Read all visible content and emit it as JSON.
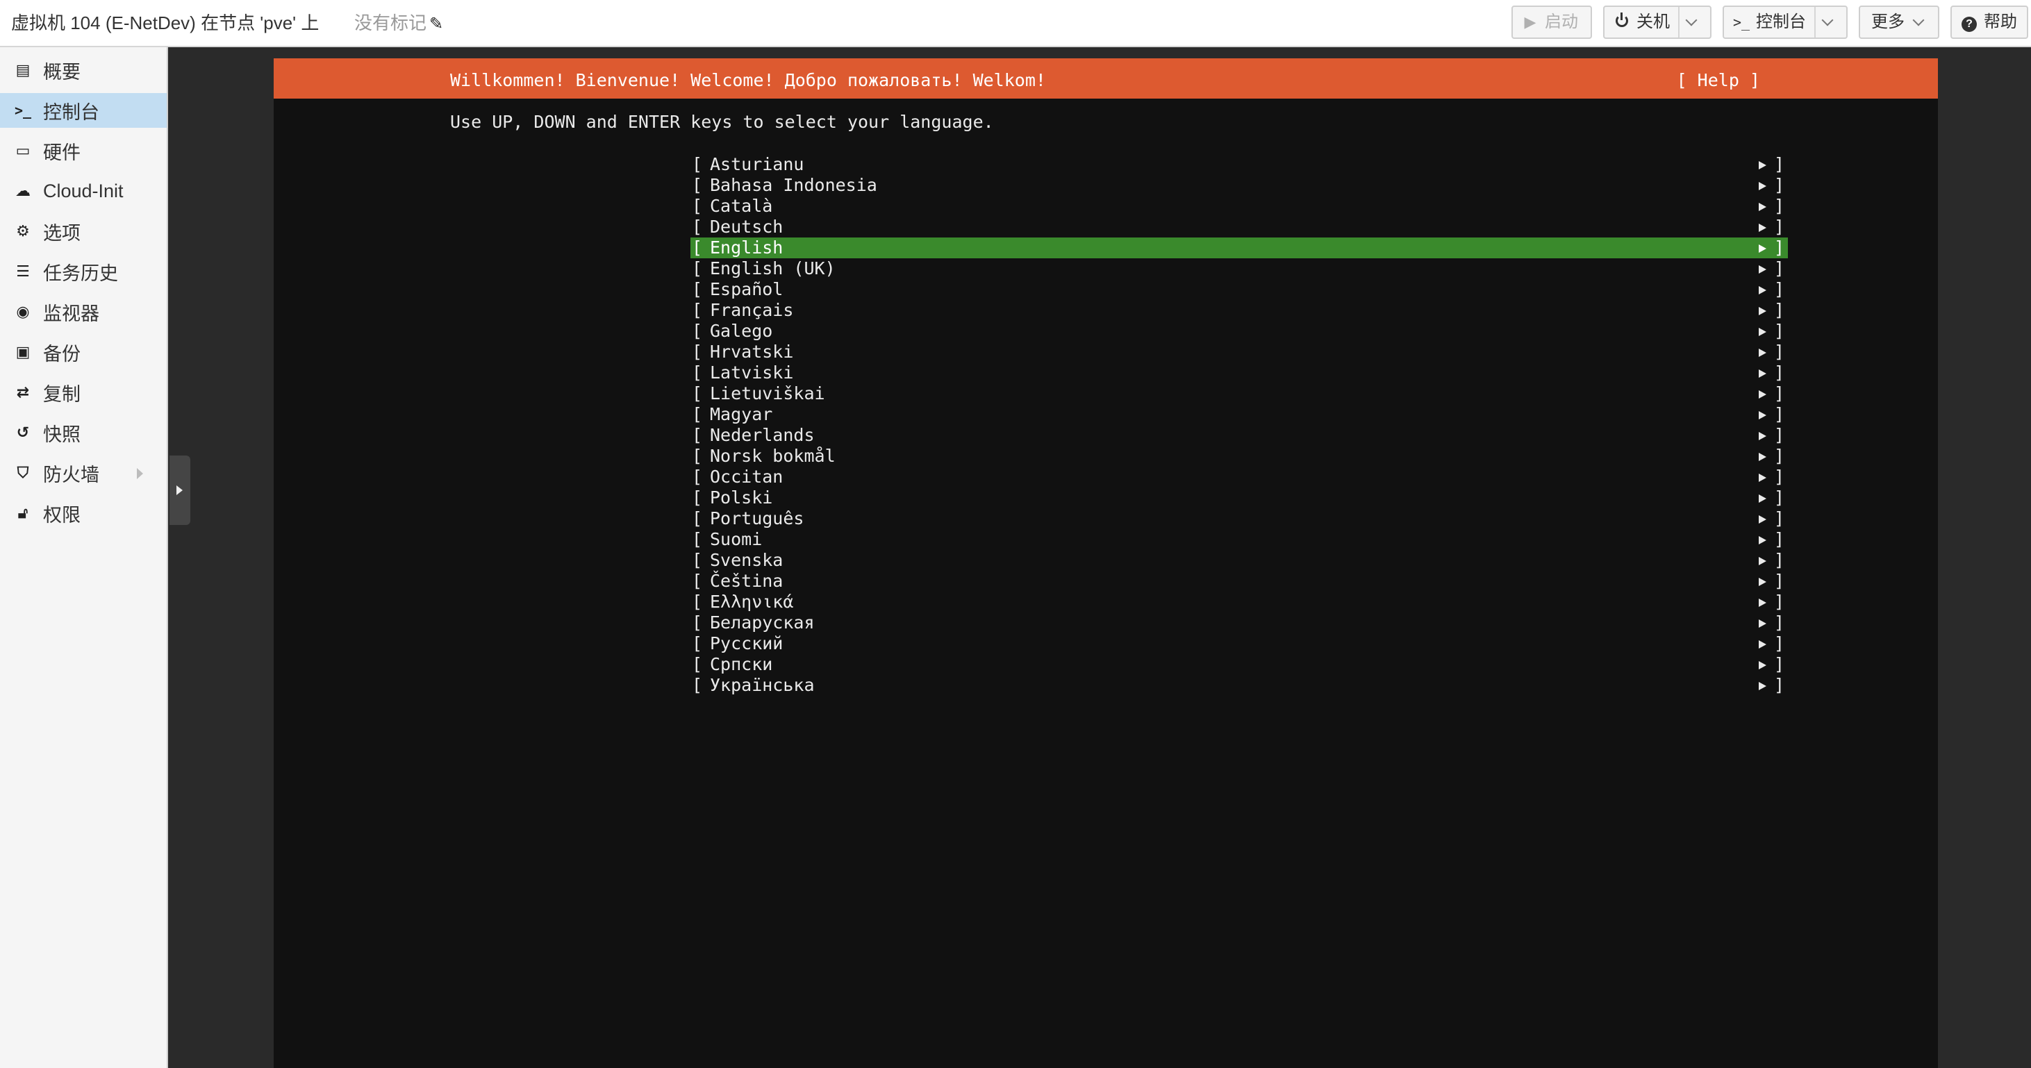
{
  "header": {
    "title": "虚拟机 104 (E-NetDev) 在节点 'pve' 上",
    "tags_label": "没有标记",
    "tags_edit_icon": "pencil-icon",
    "buttons": {
      "start": "启动",
      "shutdown": "关机",
      "console": "控制台",
      "more": "更多",
      "help": "帮助"
    }
  },
  "sidebar": {
    "items": [
      {
        "label": "概要",
        "icon": "book-icon"
      },
      {
        "label": "控制台",
        "icon": "terminal-icon"
      },
      {
        "label": "硬件",
        "icon": "monitor-icon"
      },
      {
        "label": "Cloud-Init",
        "icon": "cloud-icon"
      },
      {
        "label": "选项",
        "icon": "gear-icon"
      },
      {
        "label": "任务历史",
        "icon": "list-icon"
      },
      {
        "label": "监视器",
        "icon": "eye-icon"
      },
      {
        "label": "备份",
        "icon": "floppy-icon"
      },
      {
        "label": "复制",
        "icon": "retweet-icon"
      },
      {
        "label": "快照",
        "icon": "history-icon"
      },
      {
        "label": "防火墙",
        "icon": "shield-icon"
      },
      {
        "label": "权限",
        "icon": "unlock-icon"
      }
    ],
    "active_index": 1
  },
  "terminal": {
    "banner": "Willkommen! Bienvenue! Welcome! Добро пожаловать! Welkom!",
    "help": "[ Help ]",
    "instructions": "Use UP, DOWN and ENTER keys to select your language.",
    "bracket_open": "[",
    "bracket_close": "]",
    "selected_language": "English",
    "languages": [
      "Asturianu",
      "Bahasa Indonesia",
      "Català",
      "Deutsch",
      "English",
      "English (UK)",
      "Español",
      "Français",
      "Galego",
      "Hrvatski",
      "Latviski",
      "Lietuviškai",
      "Magyar",
      "Nederlands",
      "Norsk bokmål",
      "Occitan",
      "Polski",
      "Português",
      "Suomi",
      "Svenska",
      "Čeština",
      "Ελληνικά",
      "Беларуская",
      "Русский",
      "Српски",
      "Українська"
    ]
  },
  "colors": {
    "banner_bg": "#dd5a30",
    "selected_bg": "#3a8a2c",
    "terminal_bg": "#111111",
    "sidebar_active": "#c2ddf2"
  }
}
